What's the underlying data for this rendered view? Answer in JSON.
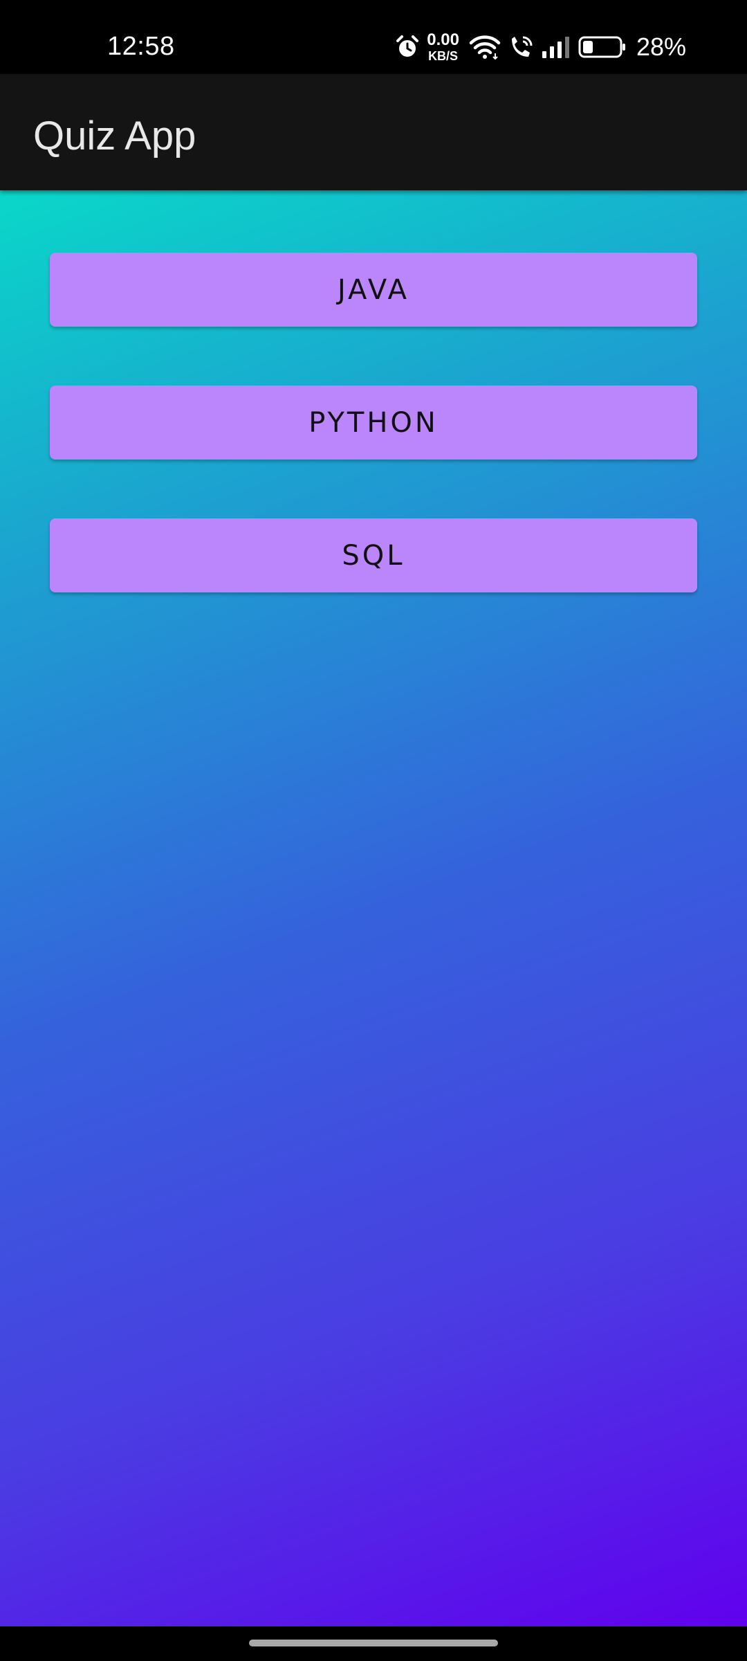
{
  "status_bar": {
    "time": "12:58",
    "network_speed_value": "0.00",
    "network_speed_unit": "KB/S",
    "battery_percent": "28%",
    "icons": [
      "alarm-icon",
      "wifi-icon",
      "wifi-calling-icon",
      "signal-icon",
      "battery-icon"
    ],
    "battery_level": 0.28
  },
  "app_bar": {
    "title": "Quiz App",
    "background": "#141414"
  },
  "quiz_topics": [
    {
      "label": "JAVA"
    },
    {
      "label": "PYTHON"
    },
    {
      "label": "SQL"
    }
  ],
  "colors": {
    "button_bg": "#bb86fc",
    "gradient_start": "#0ad7c9",
    "gradient_end": "#6100ee"
  }
}
